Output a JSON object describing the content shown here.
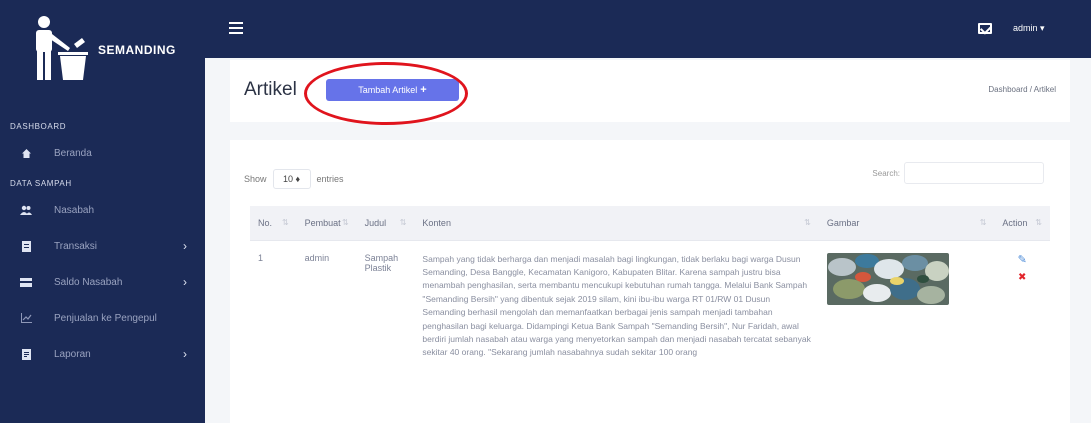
{
  "brand": {
    "name": "SEMANDING",
    "logo_icon": "person-trash-icon"
  },
  "sidebar": {
    "sections": [
      {
        "title": "DASHBOARD",
        "items": [
          {
            "label": "Beranda",
            "icon": "home-icon",
            "has_children": false
          }
        ]
      },
      {
        "title": "DATA SAMPAH",
        "items": [
          {
            "label": "Nasabah",
            "icon": "users-icon",
            "has_children": false
          },
          {
            "label": "Transaksi",
            "icon": "receipt-icon",
            "has_children": true
          },
          {
            "label": "Saldo Nasabah",
            "icon": "wallet-icon",
            "has_children": true
          },
          {
            "label": "Penjualan ke Pengepul",
            "icon": "chart-icon",
            "has_children": false
          },
          {
            "label": "Laporan",
            "icon": "report-icon",
            "has_children": true
          }
        ]
      }
    ]
  },
  "topbar": {
    "menu_icon": "hamburger-icon",
    "mail_icon": "mail-icon",
    "user": "admin ▾"
  },
  "header": {
    "title": "Artikel",
    "add_button": "Tambah Artikel",
    "add_button_icon": "+",
    "breadcrumb": "Dashboard / Artikel"
  },
  "table_controls": {
    "show_label": "Show",
    "entries_value": "10 ♦",
    "entries_label": "entries",
    "search_label": "Search:"
  },
  "table": {
    "columns": [
      "No.",
      "Pembuat",
      "Judul",
      "Konten",
      "Gambar",
      "Action"
    ],
    "rows": [
      {
        "no": "1",
        "pembuat": "admin",
        "judul": "Sampah Plastik",
        "konten": "Sampah yang tidak berharga dan menjadi masalah bagi lingkungan, tidak berlaku bagi warga Dusun Semanding, Desa Banggle, Kecamatan Kanigoro, Kabupaten Blitar. Karena sampah justru bisa menambah penghasilan, serta membantu mencukupi kebutuhan rumah tangga. Melalui Bank Sampah \"Semanding Bersih\" yang dibentuk sejak 2019 silam, kini ibu-ibu warga RT 01/RW 01 Dusun Semanding berhasil mengolah dan memanfaatkan berbagai jenis sampah menjadi tambahan penghasilan bagi keluarga. Didampingi Ketua Bank Sampah \"Semanding Bersih\", Nur Faridah, awal berdiri jumlah nasabah atau warga yang menyetorkan sampah dan menjadi nasabah tercatat sebanyak sekitar 40 orang. \"Sekarang jumlah nasabahnya sudah sekitar 100 orang"
      }
    ]
  },
  "colors": {
    "sidebar_bg": "#1b2a56",
    "accent": "#6673e9",
    "highlight": "#e0141d"
  }
}
